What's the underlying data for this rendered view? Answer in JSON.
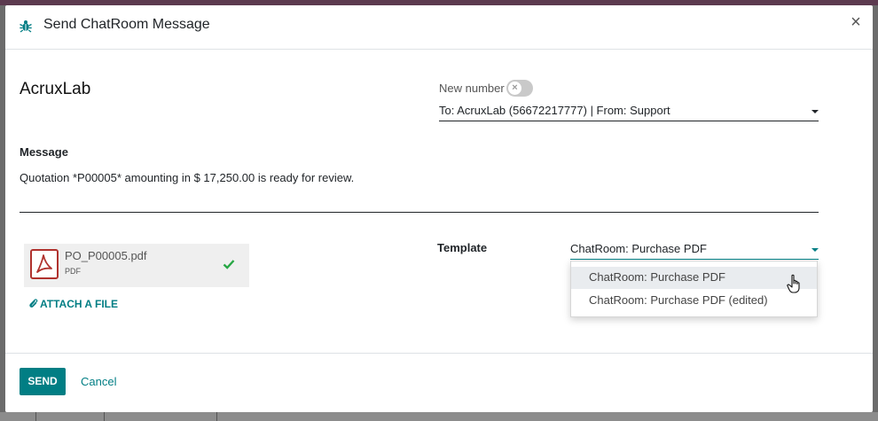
{
  "dialog": {
    "title": "Send ChatRoom Message",
    "close_label": "×"
  },
  "partner": {
    "name": "AcruxLab"
  },
  "new_number": {
    "label": "New number",
    "enabled": false
  },
  "to_select": {
    "value": "To: AcruxLab (56672217777) | From: Support"
  },
  "message": {
    "label": "Message",
    "text": "Quotation *P00005* amounting in $ 17,250.00 is ready for review."
  },
  "attachment": {
    "filename": "PO_P00005.pdf",
    "type": "PDF",
    "attach_link": "ATTACH A FILE"
  },
  "template": {
    "label": "Template",
    "value": "ChatRoom: Purchase PDF",
    "options": [
      {
        "label": "ChatRoom: Purchase PDF"
      },
      {
        "label": "ChatRoom: Purchase PDF (edited)"
      }
    ]
  },
  "footer": {
    "send_label": "SEND",
    "cancel_label": "Cancel"
  },
  "colors": {
    "accent": "#017e84",
    "pdf_red": "#b0322e",
    "check_green": "#28a745"
  }
}
